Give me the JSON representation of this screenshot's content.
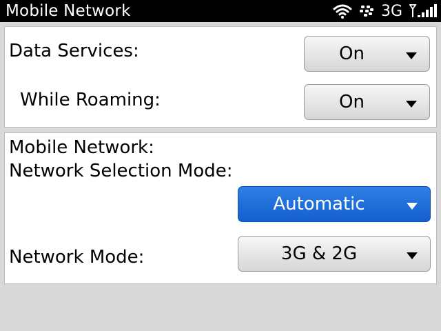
{
  "status_bar": {
    "title": "Mobile Network",
    "network_type": "3G",
    "icons": [
      "wifi-icon",
      "blackberry-logo-icon",
      "signal-strength-icon"
    ]
  },
  "data_services": {
    "label": "Data Services:",
    "value": "On"
  },
  "while_roaming": {
    "label": "While Roaming:",
    "value": "On"
  },
  "mobile_network": {
    "heading": "Mobile Network:",
    "selection_mode_label": "Network Selection Mode:",
    "selection_mode_value": "Automatic",
    "network_mode_label": "Network Mode:",
    "network_mode_value": "3G & 2G"
  },
  "colors": {
    "status_bar": "#000000",
    "selected_dropdown": "#1f6fdc",
    "background": "#d9d9d9"
  }
}
